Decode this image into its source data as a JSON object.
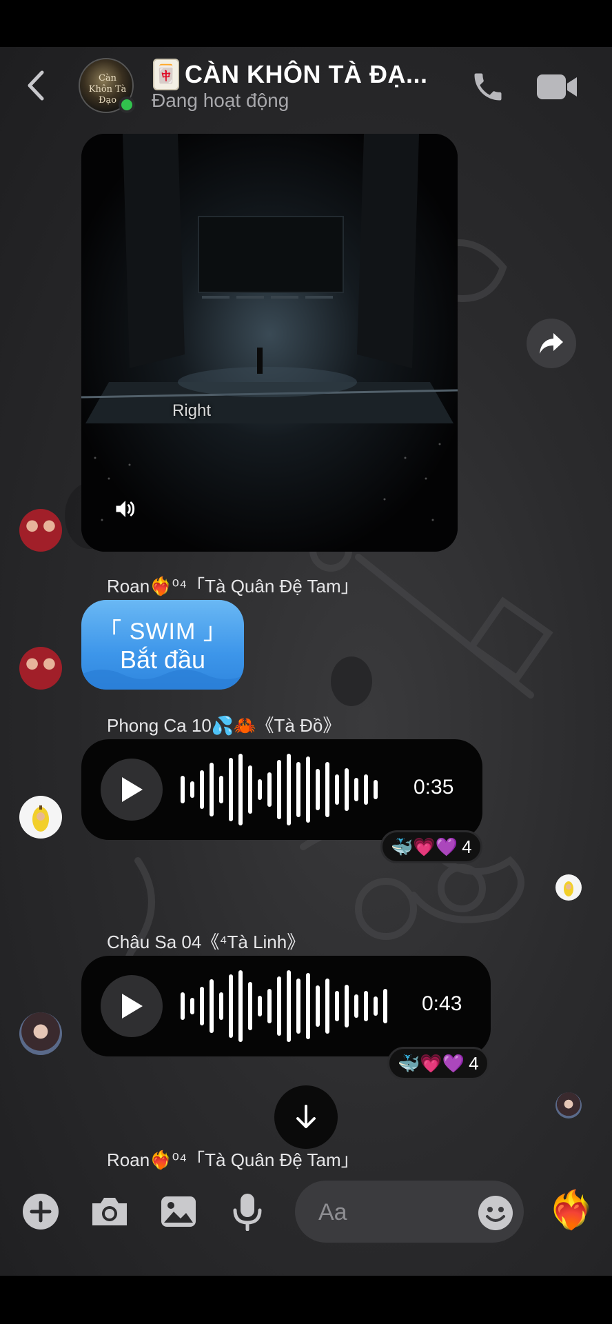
{
  "header": {
    "title_emoji": "🀄",
    "title": "CÀN KHÔN TÀ ĐẠ...",
    "status": "Đang hoạt động",
    "avatar_text": "Càn Khôn Tà Đạo"
  },
  "video": {
    "caption": "Right"
  },
  "messages": [
    {
      "sender": "Roan❤️‍🔥⁰⁴「Tà Quân Đệ Tam」"
    },
    {
      "sender": "Phong Ca 10💦🦀《Tà Đồ》"
    },
    {
      "sender": "Châu Sa 04《⁴Tà Linh》"
    },
    {
      "sender": "Roan❤️‍🔥⁰⁴「Tà Quân Đệ Tam」"
    }
  ],
  "swim": {
    "line1": "「 SWIM 」",
    "line2": "Bắt đầu"
  },
  "voice": [
    {
      "duration": "0:35",
      "reactions": "🐳💗💜",
      "count": "4"
    },
    {
      "duration": "0:43",
      "reactions": "🐳💗💜",
      "count": "4"
    }
  ],
  "composer": {
    "placeholder": "Aa",
    "like_emoji": "❤️‍🔥"
  },
  "colors": {
    "online": "#31c24d",
    "swim_bubble": "#3d96ea",
    "chat_bg": "#2b2b2d"
  }
}
